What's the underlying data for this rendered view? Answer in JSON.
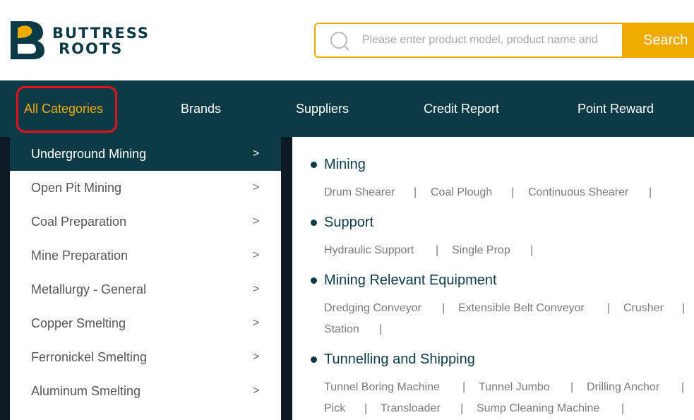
{
  "brand": {
    "line1": "BUTTRESS",
    "line2": "ROOTS"
  },
  "colors": {
    "primary": "#0d3b45",
    "accent": "#f0ab00",
    "highlight": "#e8101a"
  },
  "search": {
    "placeholder": "Please enter product model, product name and",
    "button_label": "Search",
    "icon": "search-icon"
  },
  "nav": {
    "items": [
      {
        "label": "All Categories"
      },
      {
        "label": "Brands"
      },
      {
        "label": "Suppliers"
      },
      {
        "label": "Credit Report"
      },
      {
        "label": "Point Reward"
      }
    ]
  },
  "categories": {
    "arrow": ">",
    "items": [
      {
        "label": "Underground Mining"
      },
      {
        "label": "Open Pit Mining"
      },
      {
        "label": "Coal Preparation"
      },
      {
        "label": "Mine Preparation"
      },
      {
        "label": "Metallurgy - General"
      },
      {
        "label": "Copper Smelting"
      },
      {
        "label": "Ferronickel Smelting"
      },
      {
        "label": "Aluminum Smelting"
      }
    ]
  },
  "subcategories": {
    "separator": "|",
    "groups": [
      {
        "title": "Mining",
        "links": [
          "Drum Shearer",
          "Coal Plough",
          "Continuous Shearer"
        ]
      },
      {
        "title": "Support",
        "links": [
          "Hydraulic Support",
          "Single Prop"
        ]
      },
      {
        "title": "Mining Relevant Equipment",
        "links": [
          "Dredging Conveyor",
          "Extensible Belt Conveyor",
          "Crusher",
          "Station"
        ]
      },
      {
        "title": "Tunnelling and Shipping",
        "links": [
          "Tunnel Boring Machine",
          "Tunnel Jumbo",
          "Drilling Anchor",
          "Pick",
          "Transloader",
          "Sump Cleaning Machine"
        ]
      }
    ]
  }
}
